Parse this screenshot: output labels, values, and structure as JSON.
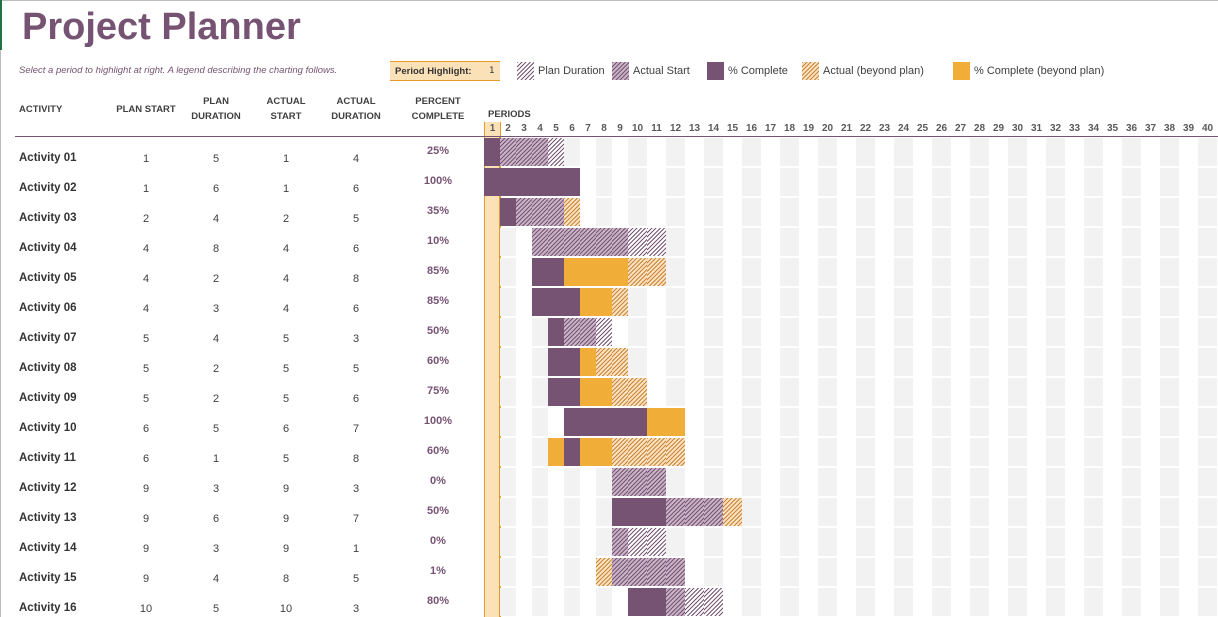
{
  "title": "Project Planner",
  "subtitle": "Select a period to highlight at right.  A legend describing the charting follows.",
  "period_highlight": {
    "label": "Period Highlight:",
    "value": "1"
  },
  "legend": [
    {
      "key": "plan",
      "label": "Plan Duration",
      "icon": "hatch-plan-swatch"
    },
    {
      "key": "actual",
      "label": "Actual Start",
      "icon": "hatch-actual-swatch"
    },
    {
      "key": "complete",
      "label": "% Complete",
      "icon": "solid-complete-swatch"
    },
    {
      "key": "beyond",
      "label": "Actual (beyond plan)",
      "icon": "hatch-beyond-swatch"
    },
    {
      "key": "complete_beyond",
      "label": "% Complete (beyond plan)",
      "icon": "solid-beyond-swatch"
    }
  ],
  "colors": {
    "accent": "#765372",
    "actual_hatch": "#c9b3c7",
    "beyond": "#f0ad37",
    "beyond_hatch": "#fde2bf",
    "highlight": "#fbe1b8",
    "highlight_border": "#e69a2e",
    "shade": "#f2f2f2"
  },
  "columns": {
    "activity": "ACTIVITY",
    "plan_start": "PLAN START",
    "plan_duration_1": "PLAN",
    "plan_duration_2": "DURATION",
    "actual_start_1": "ACTUAL",
    "actual_start_2": "START",
    "actual_duration_1": "ACTUAL",
    "actual_duration_2": "DURATION",
    "percent_1": "PERCENT",
    "percent_2": "COMPLETE",
    "periods": "PERIODS"
  },
  "periods": [
    1,
    2,
    3,
    4,
    5,
    6,
    7,
    8,
    9,
    10,
    11,
    12,
    13,
    14,
    15,
    16,
    17,
    18,
    19,
    20,
    21,
    22,
    23,
    24,
    25,
    26,
    27,
    28,
    29,
    30,
    31,
    32,
    33,
    34,
    35,
    36,
    37,
    38,
    39,
    40
  ],
  "chart_data": {
    "type": "table",
    "title": "Project Planner",
    "highlighted_period": 1,
    "rows": [
      {
        "activity": "Activity 01",
        "plan_start": 1,
        "plan_duration": 5,
        "actual_start": 1,
        "actual_duration": 4,
        "percent_complete": "25%"
      },
      {
        "activity": "Activity 02",
        "plan_start": 1,
        "plan_duration": 6,
        "actual_start": 1,
        "actual_duration": 6,
        "percent_complete": "100%"
      },
      {
        "activity": "Activity 03",
        "plan_start": 2,
        "plan_duration": 4,
        "actual_start": 2,
        "actual_duration": 5,
        "percent_complete": "35%"
      },
      {
        "activity": "Activity 04",
        "plan_start": 4,
        "plan_duration": 8,
        "actual_start": 4,
        "actual_duration": 6,
        "percent_complete": "10%"
      },
      {
        "activity": "Activity 05",
        "plan_start": 4,
        "plan_duration": 2,
        "actual_start": 4,
        "actual_duration": 8,
        "percent_complete": "85%"
      },
      {
        "activity": "Activity 06",
        "plan_start": 4,
        "plan_duration": 3,
        "actual_start": 4,
        "actual_duration": 6,
        "percent_complete": "85%"
      },
      {
        "activity": "Activity 07",
        "plan_start": 5,
        "plan_duration": 4,
        "actual_start": 5,
        "actual_duration": 3,
        "percent_complete": "50%"
      },
      {
        "activity": "Activity 08",
        "plan_start": 5,
        "plan_duration": 2,
        "actual_start": 5,
        "actual_duration": 5,
        "percent_complete": "60%"
      },
      {
        "activity": "Activity 09",
        "plan_start": 5,
        "plan_duration": 2,
        "actual_start": 5,
        "actual_duration": 6,
        "percent_complete": "75%"
      },
      {
        "activity": "Activity 10",
        "plan_start": 6,
        "plan_duration": 5,
        "actual_start": 6,
        "actual_duration": 7,
        "percent_complete": "100%"
      },
      {
        "activity": "Activity 11",
        "plan_start": 6,
        "plan_duration": 1,
        "actual_start": 5,
        "actual_duration": 8,
        "percent_complete": "60%"
      },
      {
        "activity": "Activity 12",
        "plan_start": 9,
        "plan_duration": 3,
        "actual_start": 9,
        "actual_duration": 3,
        "percent_complete": "0%"
      },
      {
        "activity": "Activity 13",
        "plan_start": 9,
        "plan_duration": 6,
        "actual_start": 9,
        "actual_duration": 7,
        "percent_complete": "50%"
      },
      {
        "activity": "Activity 14",
        "plan_start": 9,
        "plan_duration": 3,
        "actual_start": 9,
        "actual_duration": 1,
        "percent_complete": "0%"
      },
      {
        "activity": "Activity 15",
        "plan_start": 9,
        "plan_duration": 4,
        "actual_start": 8,
        "actual_duration": 5,
        "percent_complete": "1%"
      },
      {
        "activity": "Activity 16",
        "plan_start": 10,
        "plan_duration": 5,
        "actual_start": 10,
        "actual_duration": 3,
        "percent_complete": "80%"
      }
    ]
  }
}
